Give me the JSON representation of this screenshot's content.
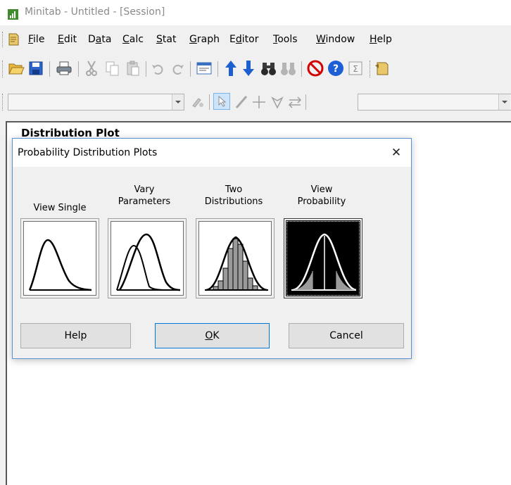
{
  "window": {
    "title": "Minitab - Untitled - [Session]",
    "icon": "minitab-app-icon"
  },
  "menu": {
    "items": [
      {
        "label": "File",
        "mnemonic": "F",
        "rest": "ile"
      },
      {
        "label": "Edit",
        "mnemonic": "E",
        "rest": "dit"
      },
      {
        "label": "Data",
        "mnemonic": "",
        "pre": "D",
        "mn": "a",
        "post": "ta"
      },
      {
        "label": "Calc",
        "mnemonic": "C",
        "rest": "alc"
      },
      {
        "label": "Stat",
        "mnemonic": "S",
        "rest": "tat"
      },
      {
        "label": "Graph",
        "mnemonic": "G",
        "rest": "raph"
      },
      {
        "label": "Editor",
        "mnemonic": "",
        "pre": "E",
        "mn": "d",
        "post": "itor"
      },
      {
        "label": "Tools",
        "mnemonic": "T",
        "rest": "ools"
      },
      {
        "label": "Window",
        "mnemonic": "W",
        "rest": "indow"
      },
      {
        "label": "Help",
        "mnemonic": "H",
        "rest": "elp"
      }
    ]
  },
  "session": {
    "partial_text": "Distribution Plot"
  },
  "dialog": {
    "title": "Probability Distribution Plots",
    "close_glyph": "✕",
    "options": [
      {
        "line1": "",
        "line2": "View Single"
      },
      {
        "line1": "Vary",
        "line2": "Parameters"
      },
      {
        "line1": "Two",
        "line2": "Distributions"
      },
      {
        "line1": "View",
        "line2": "Probability"
      }
    ],
    "selected_option": "View Probability",
    "buttons": {
      "help": "Help",
      "ok_mnemonic": "O",
      "ok_rest": "K",
      "cancel": "Cancel"
    }
  },
  "colors": {
    "dialog_border": "#5b8fd6",
    "title_text": "#8a8a8a",
    "toolbar_arrow_blue": "#1c5fd0",
    "stop_red": "#d20000"
  }
}
